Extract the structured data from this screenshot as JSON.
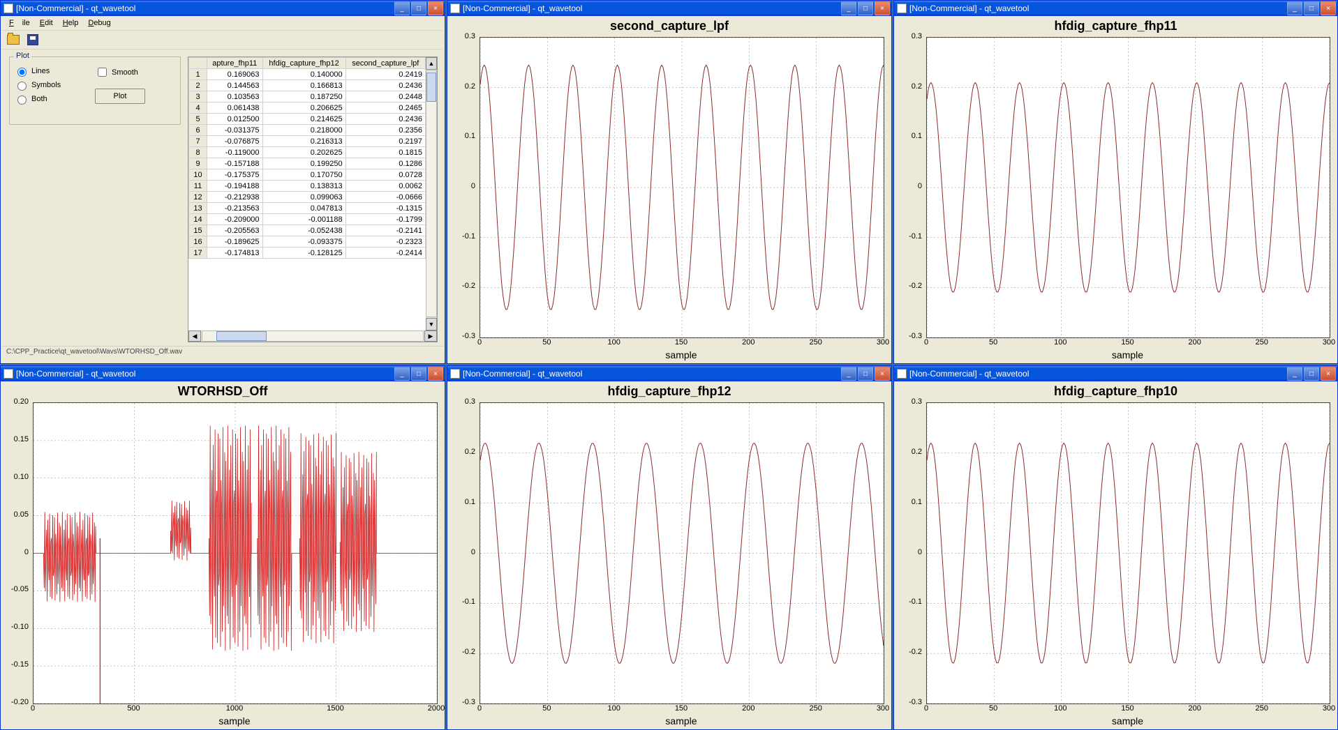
{
  "app_title_commercial": "[Non-Commercial] - qt_wavetool",
  "menu": {
    "file": "File",
    "edit": "Edit",
    "help": "Help",
    "debug": "Debug"
  },
  "plot_group": {
    "title": "Plot",
    "radio_lines": "Lines",
    "radio_symbols": "Symbols",
    "radio_both": "Both",
    "check_smooth": "Smooth",
    "plot_btn": "Plot"
  },
  "table": {
    "headers": [
      "apture_fhp11",
      "hfdig_capture_fhp12",
      "second_capture_lpf"
    ],
    "rows": [
      [
        "1",
        "0.169063",
        "0.140000",
        "0.2419"
      ],
      [
        "2",
        "0.144563",
        "0.166813",
        "0.2436"
      ],
      [
        "3",
        "0.103563",
        "0.187250",
        "0.2448"
      ],
      [
        "4",
        "0.061438",
        "0.206625",
        "0.2465"
      ],
      [
        "5",
        "0.012500",
        "0.214625",
        "0.2436"
      ],
      [
        "6",
        "-0.031375",
        "0.218000",
        "0.2356"
      ],
      [
        "7",
        "-0.076875",
        "0.216313",
        "0.2197"
      ],
      [
        "8",
        "-0.119000",
        "0.202625",
        "0.1815"
      ],
      [
        "9",
        "-0.157188",
        "0.199250",
        "0.1286"
      ],
      [
        "10",
        "-0.175375",
        "0.170750",
        "0.0728"
      ],
      [
        "11",
        "-0.194188",
        "0.138313",
        "0.0062"
      ],
      [
        "12",
        "-0.212938",
        "0.099063",
        "-0.0666"
      ],
      [
        "13",
        "-0.213563",
        "0.047813",
        "-0.1315"
      ],
      [
        "14",
        "-0.209000",
        "-0.001188",
        "-0.1799"
      ],
      [
        "15",
        "-0.205563",
        "-0.052438",
        "-0.2141"
      ],
      [
        "16",
        "-0.189625",
        "-0.093375",
        "-0.2323"
      ],
      [
        "17",
        "-0.174813",
        "-0.128125",
        "-0.2414"
      ]
    ]
  },
  "status_path": "C:\\CPP_Practice\\qt_wavetool\\Wavs\\WTORHSD_Off.wav",
  "charts": {
    "second_capture_lpf": {
      "title": "second_capture_lpf",
      "xlabel": "sample"
    },
    "hfdig_capture_fhp11": {
      "title": "hfdig_capture_fhp11",
      "xlabel": "sample"
    },
    "hfdig_capture_fhp12": {
      "title": "hfdig_capture_fhp12",
      "xlabel": "sample"
    },
    "hfdig_capture_fhp10": {
      "title": "hfdig_capture_fhp10",
      "xlabel": "sample"
    },
    "wtorhsd_off": {
      "title": "WTORHSD_Off",
      "xlabel": "sample"
    }
  },
  "chart_data": [
    {
      "type": "line",
      "title": "second_capture_lpf",
      "xlabel": "sample",
      "ylabel": "",
      "xlim": [
        0,
        300
      ],
      "ylim": [
        -0.3,
        0.3
      ],
      "series": [
        {
          "name": "second_capture_lpf",
          "amplitude": 0.245,
          "period": 33,
          "color": "#8b2b2b",
          "kind": "sine"
        }
      ]
    },
    {
      "type": "line",
      "title": "hfdig_capture_fhp11",
      "xlabel": "sample",
      "ylabel": "",
      "xlim": [
        0,
        300
      ],
      "ylim": [
        -0.3,
        0.3
      ],
      "series": [
        {
          "name": "hfdig_capture_fhp11",
          "amplitude": 0.21,
          "period": 33,
          "color": "#8b2b2b",
          "kind": "sine"
        }
      ]
    },
    {
      "type": "line",
      "title": "hfdig_capture_fhp12",
      "xlabel": "sample",
      "ylabel": "",
      "xlim": [
        0,
        300
      ],
      "ylim": [
        -0.3,
        0.3
      ],
      "series": [
        {
          "name": "hfdig_capture_fhp12",
          "amplitude": 0.22,
          "period": 40,
          "color": "#8b2b2b",
          "kind": "sine"
        }
      ]
    },
    {
      "type": "line",
      "title": "hfdig_capture_fhp10",
      "xlabel": "sample",
      "ylabel": "",
      "xlim": [
        0,
        300
      ],
      "ylim": [
        -0.3,
        0.3
      ],
      "series": [
        {
          "name": "hfdig_capture_fhp10",
          "amplitude": 0.22,
          "period": 33,
          "color": "#8b2b2b",
          "kind": "sine"
        }
      ]
    },
    {
      "type": "line",
      "title": "WTORHSD_Off",
      "xlabel": "sample",
      "ylabel": "",
      "xlim": [
        0,
        2000
      ],
      "ylim": [
        -0.2,
        0.2
      ],
      "series": [
        {
          "name": "WTORHSD_Off",
          "color": "#d01010",
          "kind": "waveform-bursts",
          "bursts": [
            {
              "start": 50,
              "end": 310,
              "amp": 0.06,
              "baseline": -0.005
            },
            {
              "start": 680,
              "end": 780,
              "amp": 0.04,
              "baseline": 0.03
            },
            {
              "start": 870,
              "end": 1080,
              "amp": 0.15,
              "baseline": 0.02
            },
            {
              "start": 1110,
              "end": 1280,
              "amp": 0.15,
              "baseline": 0.02
            },
            {
              "start": 1320,
              "end": 1500,
              "amp": 0.14,
              "baseline": 0.02
            },
            {
              "start": 1520,
              "end": 1700,
              "amp": 0.12,
              "baseline": 0.015
            }
          ],
          "spike": {
            "x": 330,
            "ymin": -0.21,
            "ymax": 0.02
          }
        }
      ]
    }
  ]
}
